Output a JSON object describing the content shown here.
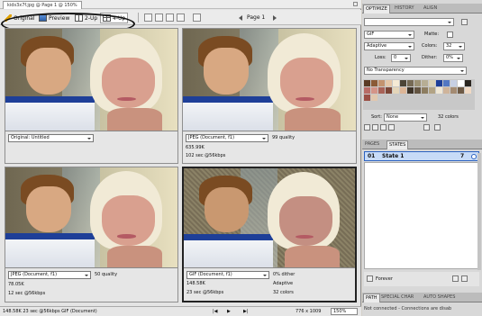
{
  "document": {
    "tab_title": "kids3x7f.jpg @ Page 1 @ 150%"
  },
  "toolbar": {
    "tabs": [
      {
        "label": "Original"
      },
      {
        "label": "Preview"
      },
      {
        "label": "2-Up"
      },
      {
        "label": "4-Up"
      }
    ],
    "page_label": "Page 1"
  },
  "panes": [
    {
      "format": "Original: Untitled",
      "right_line1": "",
      "line2": "",
      "line3": "",
      "right_line2": "",
      "right_line3": ""
    },
    {
      "format": "JPEG (Document, f1)",
      "right_line1": "99 quality",
      "line2": "635.99K",
      "line3": "102 sec @56kbps",
      "right_line2": "",
      "right_line3": ""
    },
    {
      "format": "JPEG (Document, f1)",
      "right_line1": "50 quality",
      "line2": "78.05K",
      "line3": "12 sec @56kbps",
      "right_line2": "",
      "right_line3": ""
    },
    {
      "format": "GIF (Document, f1)",
      "right_line1": "0% dither",
      "line2": "148.58K",
      "line3": "23 sec @56kbps",
      "right_line2": "Adaptive",
      "right_line3": "32 colors"
    }
  ],
  "statusbar": {
    "info": "148.58K  23 sec @56kbps  GIF (Document)",
    "dims": "776 x 1009",
    "zoom": "150%"
  },
  "optimize_panel": {
    "tabs": [
      "OPTIMIZE",
      "HISTORY",
      "ALIGN"
    ],
    "settings_value": "",
    "format": "GIF",
    "matte_label": "Matte:",
    "palette": "Adaptive",
    "colors_label": "Colors:",
    "colors_value": "32",
    "loss_label": "Loss:",
    "loss_value": "0",
    "dither_label": "Dither:",
    "dither_value": "0%",
    "transparency": "No Transparency",
    "sort_label": "Sort:",
    "sort_value": "None",
    "color_count": "32 colors",
    "swatch_colors": [
      "#5a3b24",
      "#8b5a36",
      "#c3936f",
      "#e5c6a7",
      "#f5ead5",
      "#4c4436",
      "#766a55",
      "#9c9174",
      "#b7ae94",
      "#d9d1b7",
      "#1e3f98",
      "#5377c2",
      "#c7d0e4",
      "#ffffff",
      "#2a2620",
      "#b86c66",
      "#d49488",
      "#a86257",
      "#7c4637",
      "#e4d5b9",
      "#ddb697",
      "#3e3428",
      "#645542",
      "#8d7d60",
      "#b2a384",
      "#efe7d4",
      "#cfb49a",
      "#a48b72",
      "#6e5a45",
      "#f0d9c4",
      "#9b4f45",
      "#e1c7ae"
    ]
  },
  "states_panel": {
    "tabs": [
      "PAGES",
      "STATES"
    ],
    "state_number": "01",
    "state_name": "State 1",
    "frame_delay": "7",
    "loop_label": "Forever"
  },
  "bottom_panel": {
    "tabs": [
      "PATH",
      "SPECIAL CHAR",
      "AUTO SHAPES"
    ],
    "connect_text": "Not connected - Connections are disab"
  }
}
